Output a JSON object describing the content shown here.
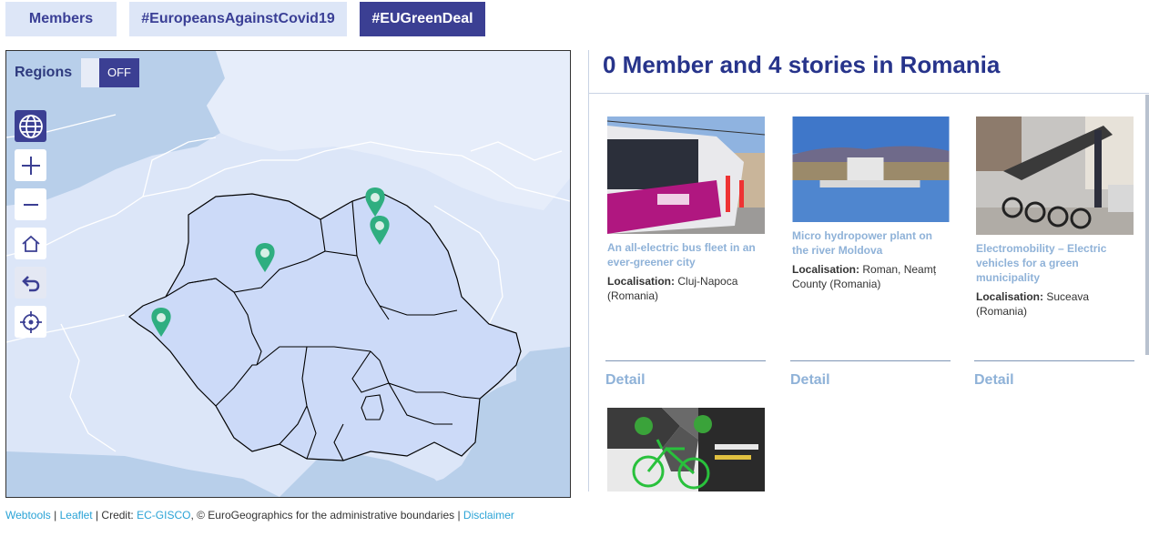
{
  "tabs": {
    "members": "Members",
    "covid": "#EuropeansAgainstCovid19",
    "green": "#EUGreenDeal"
  },
  "map": {
    "regions_label": "Regions",
    "regions_toggle": "OFF",
    "controls": [
      "globe-icon",
      "zoom-in-icon",
      "zoom-out-icon",
      "home-icon",
      "undo-icon",
      "locate-icon"
    ],
    "marker_color": "#2fae80"
  },
  "panel": {
    "title": "0 Member and 4 stories in Romania",
    "localisation_label": "Localisation:",
    "detail_label": "Detail",
    "stories": [
      {
        "title": "An all-electric bus fleet in an ever-greener city",
        "location": "Cluj-Napoca (Romania)"
      },
      {
        "title": "Micro hydropower plant on the river Moldova",
        "location": "Roman, Neamț County (Romania)"
      },
      {
        "title": "Electromobility – Electric vehicles for a green municipality",
        "location": "Suceava (Romania)"
      },
      {
        "title": "",
        "location": ""
      }
    ]
  },
  "footer": {
    "webtools": "Webtools",
    "sep1": " | ",
    "leaflet": "Leaflet",
    "credit": " | Credit: ",
    "gisco": "EC-GISCO",
    "copyright": ", © EuroGeographics for the administrative boundaries | ",
    "disclaimer": "Disclaimer"
  },
  "colors": {
    "accent": "#3b3f93",
    "tab_bg": "#dde6f7",
    "title": "#27348b",
    "link": "#2aa3d6",
    "story_title": "#8fb2d8"
  }
}
